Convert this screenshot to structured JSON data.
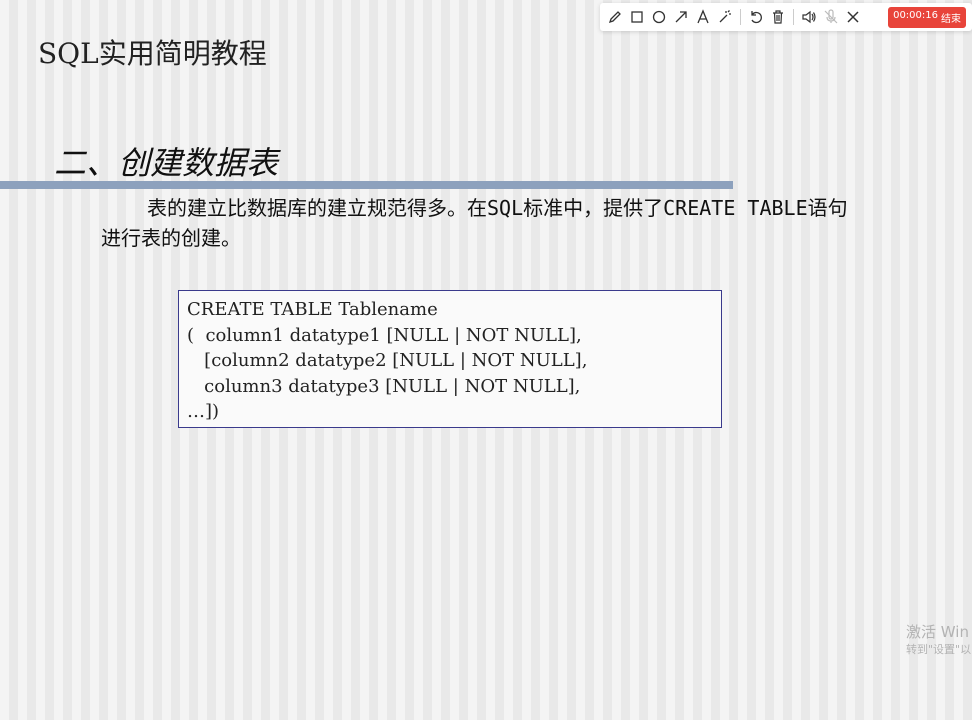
{
  "slide": {
    "title": "SQL实用简明教程",
    "section_heading": "二、创建数据表",
    "body_text": "表的建立比数据库的建立规范得多。在SQL标准中，提供了CREATE TABLE语句进行表的创建。",
    "code_lines": [
      "CREATE TABLE Tablename",
      "(  column1 datatype1 [NULL | NOT NULL],",
      "   [column2 datatype2 [NULL | NOT NULL],",
      "   column3 datatype3 [NULL | NOT NULL],",
      "…])"
    ]
  },
  "toolbar": {
    "tools": [
      "pencil-icon",
      "rectangle-icon",
      "circle-icon",
      "arrow-icon",
      "text-icon",
      "magic-wand-icon",
      "undo-icon",
      "trash-icon",
      "speaker-icon",
      "mic-off-icon",
      "close-icon"
    ],
    "timer": "00:00:16",
    "end_label": "结束",
    "accent_color": "#e8443a"
  },
  "watermark": {
    "line1": "激活 Win",
    "line2": "转到\"设置\"以"
  }
}
